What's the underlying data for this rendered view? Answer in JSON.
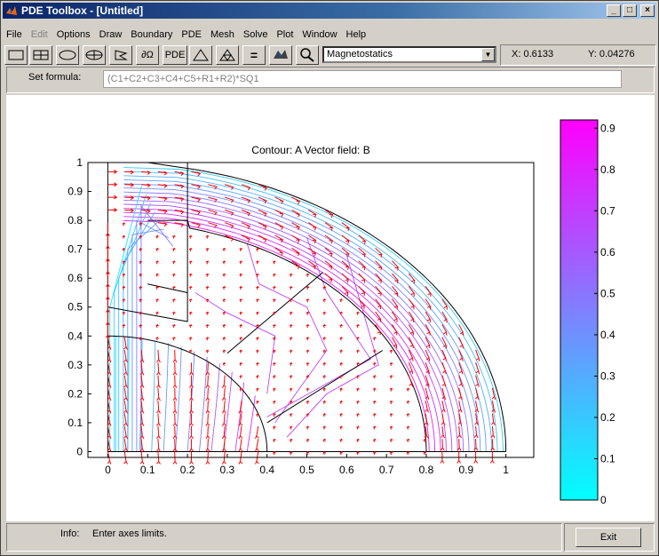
{
  "window": {
    "title": "PDE Toolbox - [Untitled]"
  },
  "menu": [
    {
      "label": "File",
      "enabled": true
    },
    {
      "label": "Edit",
      "enabled": false
    },
    {
      "label": "Options",
      "enabled": true
    },
    {
      "label": "Draw",
      "enabled": true
    },
    {
      "label": "Boundary",
      "enabled": true
    },
    {
      "label": "PDE",
      "enabled": true
    },
    {
      "label": "Mesh",
      "enabled": true
    },
    {
      "label": "Solve",
      "enabled": true
    },
    {
      "label": "Plot",
      "enabled": true
    },
    {
      "label": "Window",
      "enabled": true
    },
    {
      "label": "Help",
      "enabled": true
    }
  ],
  "toolbar": {
    "pde_label": "PDE",
    "boundary_label": "∂Ω",
    "equals_label": "=",
    "mode": "Magnetostatics"
  },
  "coords": {
    "x": "X:  0.6133",
    "y": "Y:  0.04276"
  },
  "formula": {
    "label": "Set formula:",
    "value": "(C1+C2+C3+C4+C5+R1+R2)*SQ1"
  },
  "status": {
    "info_label": "Info:",
    "message": "Enter axes limits."
  },
  "exit_label": "Exit",
  "colors": {
    "title_start": "#0a246a",
    "field_arrow": "#ff0000",
    "colormap": "cool"
  },
  "chart_data": {
    "type": "contour",
    "title": "Contour: A  Vector field: B",
    "xlim": [
      -0.05,
      1.07
    ],
    "ylim": [
      -0.02,
      1
    ],
    "xticks": [
      0,
      0.1,
      0.2,
      0.3,
      0.4,
      0.5,
      0.6,
      0.7,
      0.8,
      0.9,
      1
    ],
    "yticks": [
      0,
      0.1,
      0.2,
      0.3,
      0.4,
      0.5,
      0.6,
      0.7,
      0.8,
      0.9,
      1
    ],
    "colorbar": {
      "min": 0,
      "max": 0.92,
      "ticks": [
        0,
        0.1,
        0.2,
        0.3,
        0.4,
        0.5,
        0.6,
        0.7,
        0.8,
        0.9
      ]
    },
    "geometry": {
      "outer_radius": 1,
      "inner_radius": 0.8,
      "core_radius": 0.4,
      "coil_window": {
        "x": [
          0.1,
          0.2
        ],
        "y": [
          0.45,
          0.8
        ]
      }
    },
    "grid": false,
    "legend": "none"
  }
}
